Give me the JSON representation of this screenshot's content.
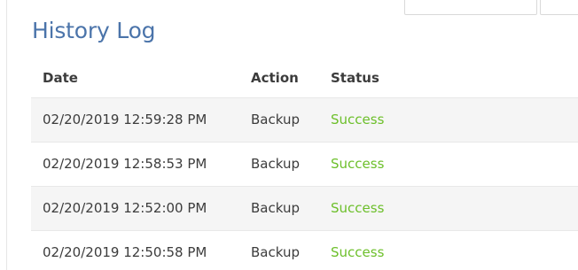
{
  "history": {
    "title": "History Log",
    "columns": {
      "date": "Date",
      "action": "Action",
      "status": "Status"
    },
    "rows": [
      {
        "date": "02/20/2019 12:59:28 PM",
        "action": "Backup",
        "status": "Success"
      },
      {
        "date": "02/20/2019 12:58:53 PM",
        "action": "Backup",
        "status": "Success"
      },
      {
        "date": "02/20/2019 12:52:00 PM",
        "action": "Backup",
        "status": "Success"
      },
      {
        "date": "02/20/2019 12:50:58 PM",
        "action": "Backup",
        "status": "Success"
      }
    ]
  },
  "colors": {
    "title": "#4b74aa",
    "success": "#6cbf2a",
    "alt_row": "#f5f5f5"
  }
}
